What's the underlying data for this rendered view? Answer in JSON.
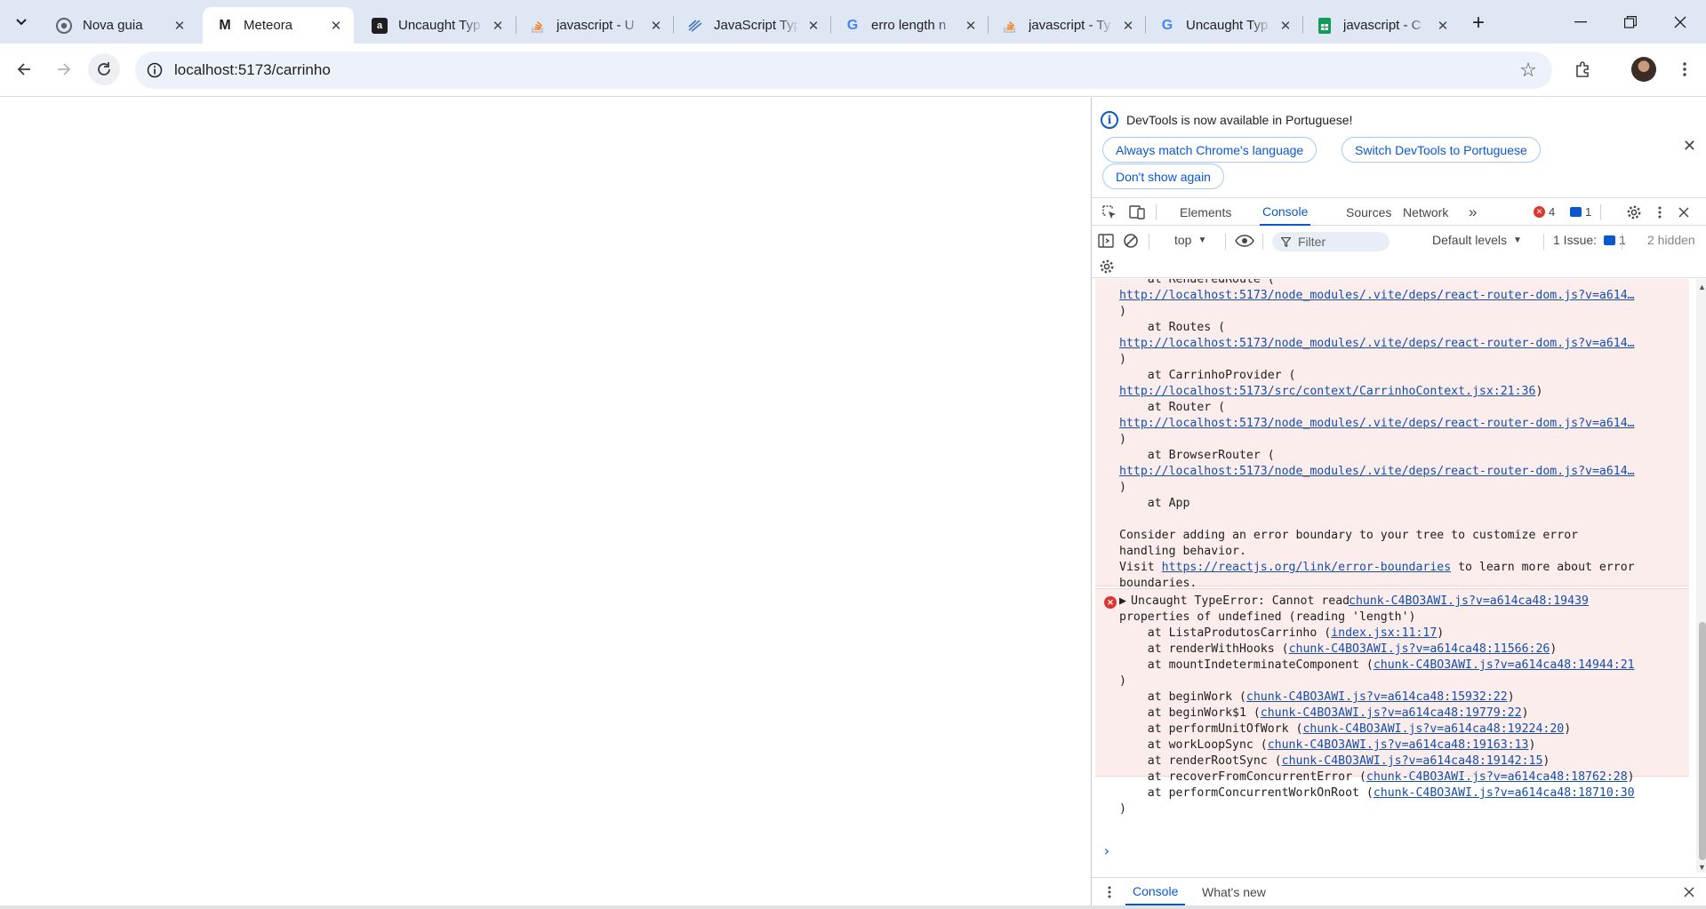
{
  "browser": {
    "tabs": [
      {
        "title": "Nova guia",
        "icon": "chrome-icon"
      },
      {
        "title": "Meteora",
        "icon": "meteora-icon"
      },
      {
        "title": "Uncaught Typ",
        "icon": "a-icon"
      },
      {
        "title": "javascript - U",
        "icon": "stackoverflow-icon"
      },
      {
        "title": "JavaScript Typ",
        "icon": "typeerror-site-icon"
      },
      {
        "title": "erro length n",
        "icon": "google-icon"
      },
      {
        "title": "javascript - Ty",
        "icon": "stackoverflow-icon"
      },
      {
        "title": "Uncaught Typ",
        "icon": "google-icon"
      },
      {
        "title": "javascript - C",
        "icon": "sheets-icon"
      }
    ],
    "active_tab": 1,
    "url": "localhost:5173/carrinho"
  },
  "devtools": {
    "infobar": {
      "message": "DevTools is now available in Portuguese!",
      "buttons": [
        "Always match Chrome's language",
        "Switch DevTools to Portuguese",
        "Don't show again"
      ]
    },
    "tabs": [
      "Elements",
      "Console",
      "Sources",
      "Network"
    ],
    "active_tab": "Console",
    "error_count": "4",
    "message_count": "1",
    "filterbar": {
      "context": "top",
      "filter_placeholder": "Filter",
      "levels": "Default levels",
      "issues_label": "1 Issue:",
      "issues_count": "1",
      "hidden": "2 hidden"
    },
    "console_lines_block1": [
      {
        "pre": "    at RenderedRoute (",
        "link": "",
        "post": ""
      },
      {
        "pre": "",
        "link": "http://localhost:5173/node_modules/.vite/deps/react-router-dom.js?v=a614…",
        "post": ""
      },
      {
        "pre": ")",
        "link": "",
        "post": ""
      },
      {
        "pre": "    at Routes (",
        "link": "",
        "post": ""
      },
      {
        "pre": "",
        "link": "http://localhost:5173/node_modules/.vite/deps/react-router-dom.js?v=a614…",
        "post": ""
      },
      {
        "pre": ")",
        "link": "",
        "post": ""
      },
      {
        "pre": "    at CarrinhoProvider (",
        "link": "",
        "post": ""
      },
      {
        "pre": "",
        "link": "http://localhost:5173/src/context/CarrinhoContext.jsx:21:36",
        "post": ")"
      },
      {
        "pre": "    at Router (",
        "link": "",
        "post": ""
      },
      {
        "pre": "",
        "link": "http://localhost:5173/node_modules/.vite/deps/react-router-dom.js?v=a614…",
        "post": ""
      },
      {
        "pre": ")",
        "link": "",
        "post": ""
      },
      {
        "pre": "    at BrowserRouter (",
        "link": "",
        "post": ""
      },
      {
        "pre": "",
        "link": "http://localhost:5173/node_modules/.vite/deps/react-router-dom.js?v=a614…",
        "post": ""
      },
      {
        "pre": ")",
        "link": "",
        "post": ""
      },
      {
        "pre": "    at App",
        "link": "",
        "post": ""
      },
      {
        "pre": "",
        "link": "",
        "post": ""
      },
      {
        "pre": "Consider adding an error boundary to your tree to customize error",
        "link": "",
        "post": ""
      },
      {
        "pre": "handling behavior.",
        "link": "",
        "post": ""
      },
      {
        "pre": "Visit ",
        "link": "https://reactjs.org/link/error-boundaries",
        "post": " to learn more about error"
      },
      {
        "pre": "boundaries.",
        "link": "",
        "post": ""
      }
    ],
    "error2": {
      "head": "Uncaught TypeError: Cannot read",
      "source": "chunk-C4BO3AWI.js?v=a614ca48:19439",
      "lines": [
        {
          "pre": "properties of undefined (reading 'length')",
          "link": "",
          "post": ""
        },
        {
          "pre": "    at ListaProdutosCarrinho (",
          "link": "index.jsx:11:17",
          "post": ")"
        },
        {
          "pre": "    at renderWithHooks (",
          "link": "chunk-C4BO3AWI.js?v=a614ca48:11566:26",
          "post": ")"
        },
        {
          "pre": "    at mountIndeterminateComponent (",
          "link": "chunk-C4BO3AWI.js?v=a614ca48:14944:21",
          "post": ""
        },
        {
          "pre": ")",
          "link": "",
          "post": ""
        },
        {
          "pre": "    at beginWork (",
          "link": "chunk-C4BO3AWI.js?v=a614ca48:15932:22",
          "post": ")"
        },
        {
          "pre": "    at beginWork$1 (",
          "link": "chunk-C4BO3AWI.js?v=a614ca48:19779:22",
          "post": ")"
        },
        {
          "pre": "    at performUnitOfWork (",
          "link": "chunk-C4BO3AWI.js?v=a614ca48:19224:20",
          "post": ")"
        },
        {
          "pre": "    at workLoopSync (",
          "link": "chunk-C4BO3AWI.js?v=a614ca48:19163:13",
          "post": ")"
        },
        {
          "pre": "    at renderRootSync (",
          "link": "chunk-C4BO3AWI.js?v=a614ca48:19142:15",
          "post": ")"
        },
        {
          "pre": "    at recoverFromConcurrentError (",
          "link": "chunk-C4BO3AWI.js?v=a614ca48:18762:28",
          "post": ")"
        },
        {
          "pre": "    at performConcurrentWorkOnRoot (",
          "link": "chunk-C4BO3AWI.js?v=a614ca48:18710:30",
          "post": ""
        },
        {
          "pre": ")",
          "link": "",
          "post": ""
        }
      ]
    },
    "drawer": {
      "tabs": [
        "Console",
        "What's new"
      ],
      "active": "Console"
    }
  },
  "colors": {
    "tabstrip": "#dfe7f5",
    "accent": "#0b57d0",
    "error_bg": "#fceded",
    "error_red": "#dc362e",
    "link": "#174ea6"
  }
}
